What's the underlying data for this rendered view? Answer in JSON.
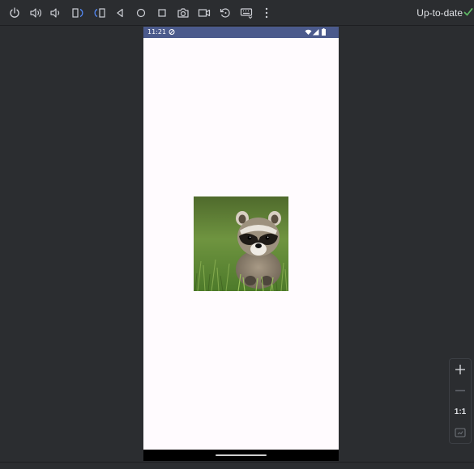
{
  "toolbar": {
    "buttons": [
      {
        "icon": "power-icon"
      },
      {
        "icon": "volume-up-icon"
      },
      {
        "icon": "volume-down-icon"
      },
      {
        "icon": "rotate-left-icon"
      },
      {
        "icon": "rotate-right-icon"
      },
      {
        "icon": "back-icon"
      },
      {
        "icon": "home-icon"
      },
      {
        "icon": "overview-icon"
      },
      {
        "icon": "camera-icon"
      },
      {
        "icon": "screen-record-icon"
      },
      {
        "icon": "reset-icon"
      },
      {
        "icon": "keyboard-icon"
      },
      {
        "icon": "more-icon"
      }
    ],
    "status": "Up-to-date",
    "status_color": "#5fb865"
  },
  "device": {
    "statusbar": {
      "time": "11:21",
      "color": "#4b5a8c"
    },
    "content": {
      "image": "raccoon-photo"
    }
  },
  "zoom": {
    "zoom_in": "+",
    "zoom_out": "−",
    "actual_size": "1:1",
    "fit_icon": "fit-screen-icon"
  }
}
